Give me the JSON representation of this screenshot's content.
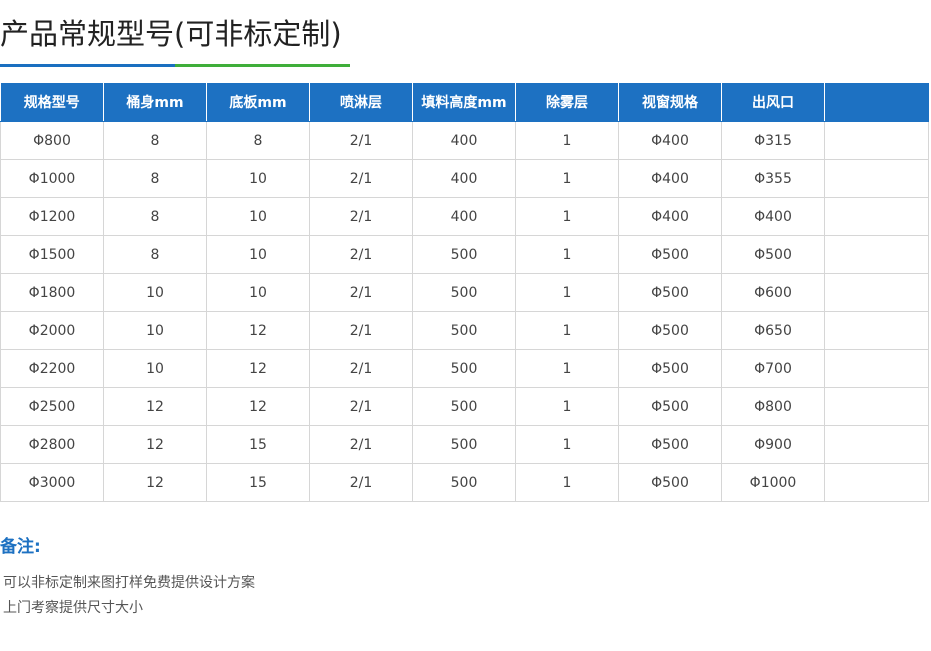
{
  "title": "产品常规型号(可非标定制)",
  "colors": {
    "header_bg": "#1d71c2",
    "accent_blue": "#1a6fc0",
    "accent_green": "#3fae3a"
  },
  "table": {
    "headers": [
      "规格型号",
      "桶身mm",
      "底板mm",
      "喷淋层",
      "填料高度mm",
      "除雾层",
      "视窗规格",
      "出风口",
      ""
    ],
    "rows": [
      [
        "Φ800",
        "8",
        "8",
        "2/1",
        "400",
        "1",
        "Φ400",
        "Φ315",
        ""
      ],
      [
        "Φ1000",
        "8",
        "10",
        "2/1",
        "400",
        "1",
        "Φ400",
        "Φ355",
        ""
      ],
      [
        "Φ1200",
        "8",
        "10",
        "2/1",
        "400",
        "1",
        "Φ400",
        "Φ400",
        ""
      ],
      [
        "Φ1500",
        "8",
        "10",
        "2/1",
        "500",
        "1",
        "Φ500",
        "Φ500",
        ""
      ],
      [
        "Φ1800",
        "10",
        "10",
        "2/1",
        "500",
        "1",
        "Φ500",
        "Φ600",
        ""
      ],
      [
        "Φ2000",
        "10",
        "12",
        "2/1",
        "500",
        "1",
        "Φ500",
        "Φ650",
        ""
      ],
      [
        "Φ2200",
        "10",
        "12",
        "2/1",
        "500",
        "1",
        "Φ500",
        "Φ700",
        ""
      ],
      [
        "Φ2500",
        "12",
        "12",
        "2/1",
        "500",
        "1",
        "Φ500",
        "Φ800",
        ""
      ],
      [
        "Φ2800",
        "12",
        "15",
        "2/1",
        "500",
        "1",
        "Φ500",
        "Φ900",
        ""
      ],
      [
        "Φ3000",
        "12",
        "15",
        "2/1",
        "500",
        "1",
        "Φ500",
        "Φ1000",
        ""
      ]
    ]
  },
  "notes": {
    "label": "备注:",
    "lines": [
      "可以非标定制来图打样免费提供设计方案",
      "上门考察提供尺寸大小"
    ]
  }
}
